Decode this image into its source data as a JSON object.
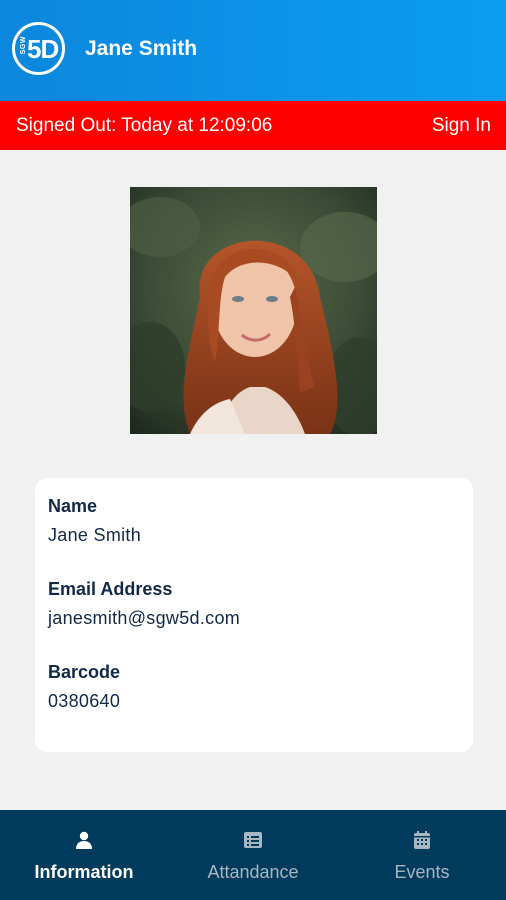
{
  "header": {
    "logo_small": "SGW",
    "logo_big": "5D",
    "title": "Jane Smith"
  },
  "status": {
    "text": "Signed Out: Today at 12:09:06",
    "action_label": "Sign In",
    "color": "#ff0000"
  },
  "profile": {
    "fields": [
      {
        "label": "Name",
        "value": "Jane Smith"
      },
      {
        "label": "Email Address",
        "value": "janesmith@sgw5d.com"
      },
      {
        "label": "Barcode",
        "value": "0380640"
      }
    ]
  },
  "tabs": [
    {
      "label": "Information",
      "icon": "person-icon",
      "active": true
    },
    {
      "label": "Attandance",
      "icon": "list-icon",
      "active": false
    },
    {
      "label": "Events",
      "icon": "calendar-icon",
      "active": false
    }
  ],
  "colors": {
    "header_blue": "#0b8fe6",
    "tabbar": "#003a5c",
    "text_dark": "#13294b"
  }
}
